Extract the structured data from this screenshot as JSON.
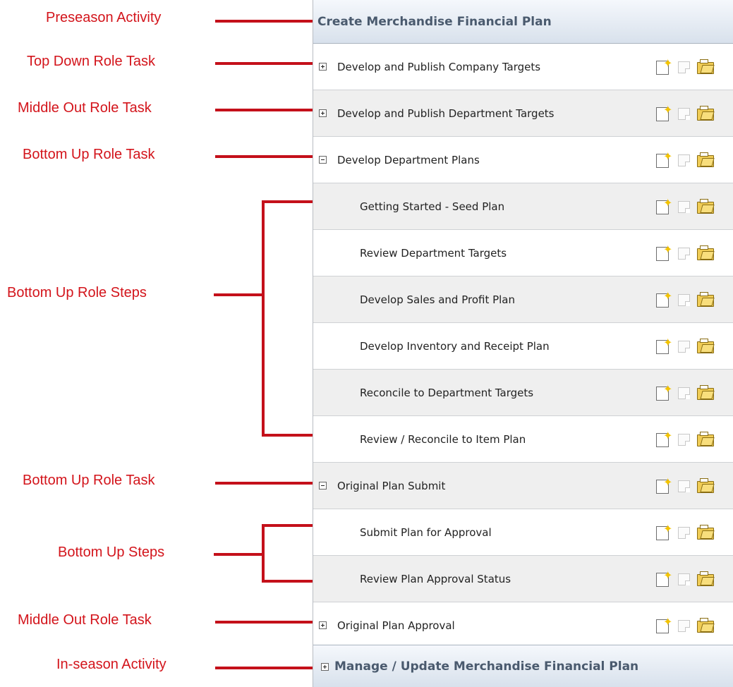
{
  "annotations": {
    "preseason": "Preseason Activity",
    "top_down_task": "Top Down Role Task",
    "middle_out_task": "Middle Out Role Task",
    "bottom_up_task": "Bottom Up Role Task",
    "bottom_up_steps": "Bottom Up Role Steps",
    "bottom_up_task_2": "Bottom Up Role Task",
    "bottom_up_steps_2": "Bottom Up Steps",
    "middle_out_task_2": "Middle Out Role Task",
    "inseason": "In-season Activity"
  },
  "panel": {
    "header_title": "Create Merchandise Financial Plan",
    "footer_title": "Manage / Update Merchandise Financial Plan",
    "rows": [
      {
        "label": "Develop and Publish Company Targets",
        "toggle": "plus"
      },
      {
        "label": "Develop and Publish Department Targets",
        "toggle": "plus"
      },
      {
        "label": "Develop Department Plans",
        "toggle": "minus"
      },
      {
        "label": "Getting Started - Seed Plan",
        "toggle": "none"
      },
      {
        "label": "Review Department Targets",
        "toggle": "none"
      },
      {
        "label": "Develop Sales and Profit Plan",
        "toggle": "none"
      },
      {
        "label": "Develop Inventory and Receipt Plan",
        "toggle": "none"
      },
      {
        "label": "Reconcile to Department Targets",
        "toggle": "none"
      },
      {
        "label": "Review / Reconcile to Item Plan",
        "toggle": "none"
      },
      {
        "label": "Original Plan Submit",
        "toggle": "minus"
      },
      {
        "label": "Submit Plan for Approval",
        "toggle": "none"
      },
      {
        "label": "Review Plan Approval Status",
        "toggle": "none"
      },
      {
        "label": "Original Plan Approval",
        "toggle": "plus"
      }
    ]
  },
  "colors": {
    "annotation_red": "#d3141b",
    "header_text": "#4a5a6e",
    "row_alt": "#efefef"
  }
}
